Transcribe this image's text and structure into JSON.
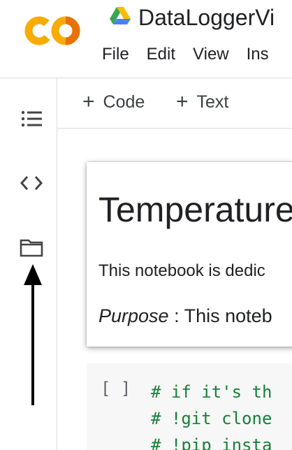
{
  "header": {
    "title": "DataLoggerVi",
    "menu": [
      "File",
      "Edit",
      "View",
      "Ins"
    ]
  },
  "toolbar": {
    "code_label": "Code",
    "text_label": "Text",
    "plus": "+"
  },
  "sidebar": {
    "icons": [
      "table-of-contents-icon",
      "code-snippets-icon",
      "files-icon"
    ]
  },
  "notebook": {
    "heading": "Temperature",
    "paragraph1": "This notebook is dedic",
    "paragraph2_em": "Purpose",
    "paragraph2_rest": " : This noteb",
    "code_cell": {
      "run_label": "[ ]",
      "lines": [
        "# if it's th",
        "# !git clone",
        "# !pip insta"
      ]
    }
  },
  "colors": {
    "accent_orange": "#f9ab00",
    "logo_orange_dark": "#e8710a",
    "code_comment_green": "#188038",
    "divider": "#dadce0"
  }
}
